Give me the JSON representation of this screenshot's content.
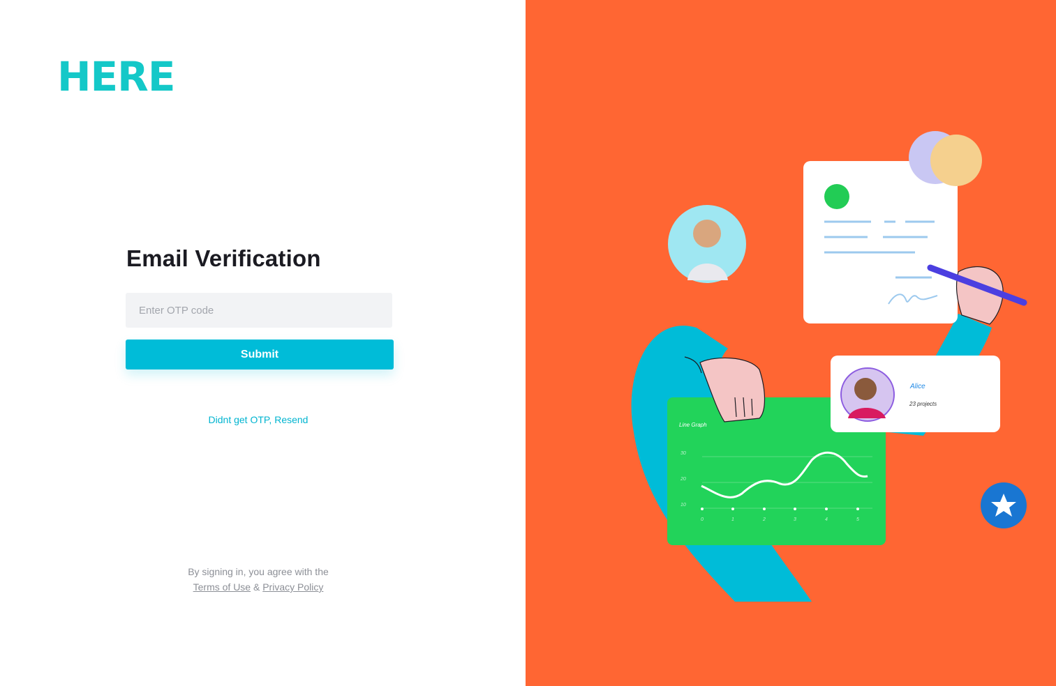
{
  "brand": {
    "logo_text": "HERE",
    "logo_color": "#14C8C8"
  },
  "form": {
    "title": "Email Verification",
    "otp_placeholder": "Enter OTP code",
    "otp_value": "",
    "submit_label": "Submit",
    "resend_label": "Didnt get OTP, Resend"
  },
  "legal": {
    "prefix": "By signing in, you agree with the",
    "terms_label": "Terms of Use",
    "separator": "&",
    "privacy_label": "Privacy Policy"
  },
  "illustration": {
    "background_color": "#FF6633",
    "graph_card": {
      "title": "Line Graph",
      "y_ticks": [
        "30",
        "20",
        "10"
      ],
      "x_ticks": [
        "0",
        "1",
        "2",
        "3",
        "4",
        "5"
      ]
    },
    "profile_card": {
      "name": "Alice",
      "subtitle": "23 projects"
    }
  },
  "colors": {
    "accent": "#00BCD8",
    "input_bg": "#F2F3F5",
    "title": "#1B1B22"
  }
}
